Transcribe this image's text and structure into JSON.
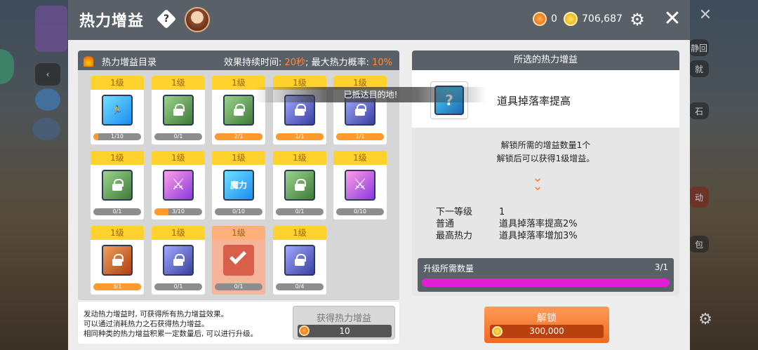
{
  "panel": {
    "title": "热力增益",
    "help_icon": "?",
    "currency": {
      "heat_stones": "0",
      "gold": "706,687"
    },
    "colors": {
      "accent": "#ff8a3d",
      "header": "#5a6068",
      "level_tab": "#ffd22e",
      "progress_purple": "#e21fd6"
    }
  },
  "catalog": {
    "title": "热力增益目录",
    "duration_label": "效果持续时间: ",
    "duration_value": "20秒",
    "separator": "; ",
    "prob_label": "最大热力概率: ",
    "prob_value": "10%",
    "cards": [
      {
        "level": "1级",
        "progress": "1/10",
        "fill": 0.1,
        "locked": false,
        "style": "a",
        "glyph": "🏃"
      },
      {
        "level": "1级",
        "progress": "0/1",
        "fill": 0,
        "locked": true,
        "style": "c"
      },
      {
        "level": "1级",
        "progress": "2/1",
        "fill": 1,
        "locked": true,
        "style": "c"
      },
      {
        "level": "1级",
        "progress": "1/1",
        "fill": 1,
        "locked": true,
        "style": "e"
      },
      {
        "level": "1级",
        "progress": "1/1",
        "fill": 1,
        "locked": true,
        "style": "e"
      },
      {
        "level": "1级",
        "progress": "0/1",
        "fill": 0,
        "locked": true,
        "style": "c"
      },
      {
        "level": "1级",
        "progress": "3/10",
        "fill": 0.3,
        "locked": false,
        "style": "b",
        "glyph": "⚔"
      },
      {
        "level": "1级",
        "progress": "0/10",
        "fill": 0,
        "locked": false,
        "style": "a",
        "glyph": "魔力"
      },
      {
        "level": "1级",
        "progress": "0/1",
        "fill": 0,
        "locked": true,
        "style": "c"
      },
      {
        "level": "1级",
        "progress": "0/10",
        "fill": 0,
        "locked": false,
        "style": "b",
        "glyph": "⚔"
      },
      {
        "level": "1级",
        "progress": "3/1",
        "fill": 1,
        "locked": true,
        "style": "d"
      },
      {
        "level": "1级",
        "progress": "0/1",
        "fill": 0,
        "locked": true,
        "style": "e"
      },
      {
        "level": "1级",
        "progress": "0/1",
        "fill": 0,
        "locked": false,
        "style": "sel",
        "selected": true
      },
      {
        "level": "1级",
        "progress": "0/4",
        "fill": 0,
        "locked": true,
        "style": "e"
      }
    ]
  },
  "toast": "已抵达目的地!",
  "description": {
    "lines": [
      "发动热力增益时, 可获得所有热力增益效果。",
      "可以通过消耗热力之石获得热力增益。",
      "相同种类的热力增益积累一定数量后, 可以进行升级。"
    ],
    "get_button": {
      "label": "获得热力增益",
      "cost": "10"
    }
  },
  "selected": {
    "header": "所选的热力增益",
    "name": "道具掉落率提高",
    "icon_glyph": "?",
    "req_line1": "解锁所需的增益数量1个",
    "req_line2": "解锁后可以获得1级增益。",
    "next_level_label": "下一等级",
    "next_level_value": "1",
    "normal_label": "普通",
    "normal_value": "道具掉落率提高2%",
    "max_label": "最高热力",
    "max_value": "道具掉落率增加3%",
    "upgrade_label": "升级所需数量",
    "upgrade_count": "3/1",
    "upgrade_fill": 1.0
  },
  "unlock_button": {
    "label": "解锁",
    "price": "300,000"
  },
  "background": {
    "right_labels": [
      "静回",
      "就",
      "石",
      "动",
      "包"
    ]
  }
}
